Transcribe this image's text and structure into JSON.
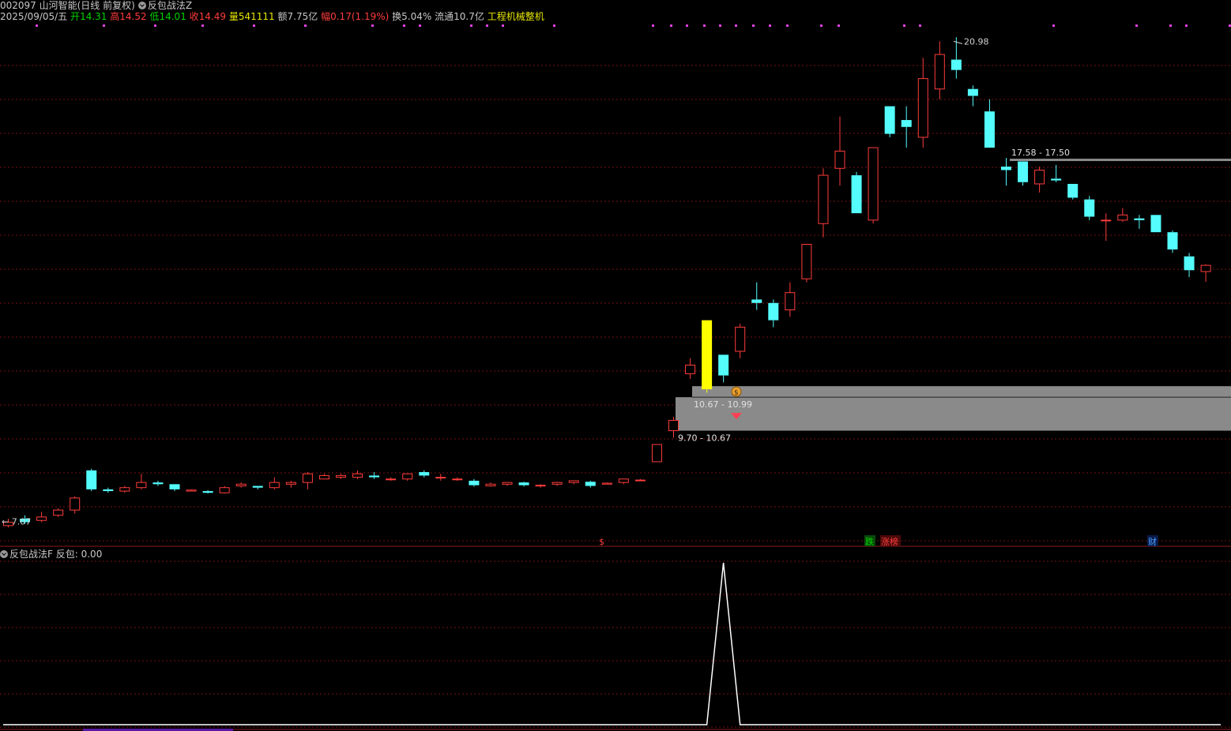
{
  "header": {
    "code_name": "002097 山河智能(日线 前复权)",
    "indicator_main": "反包战法Z",
    "date": "2025/09/05/五",
    "open_label": "开",
    "open": "14.31",
    "high_label": "高",
    "high": "14.52",
    "low_label": "低",
    "low": "14.01",
    "close_label": "收",
    "close": "14.49",
    "vol_label": "量",
    "vol": "541111",
    "amount_label": "额",
    "amount": "7.75亿",
    "change_label": "幅",
    "change": "0.17(1.19%)",
    "turnover_label": "换",
    "turnover": "5.04%",
    "float_label": "流通",
    "float": "10.7亿",
    "sector": "工程机械整机"
  },
  "main_chart": {
    "price_min": 6.9,
    "price_max": 21.4,
    "up_color": "#ff3c3c",
    "down_color": "#54fcfc",
    "candles": [
      [
        6.95,
        7.05,
        7.15,
        6.9
      ],
      [
        7.15,
        7.05,
        7.25,
        7.0
      ],
      [
        7.1,
        7.2,
        7.35,
        7.05
      ],
      [
        7.25,
        7.4,
        7.45,
        7.2
      ],
      [
        7.4,
        7.75,
        7.8,
        7.3
      ],
      [
        8.55,
        8.0,
        8.6,
        7.95
      ],
      [
        8.0,
        7.95,
        8.05,
        7.9
      ],
      [
        7.95,
        8.05,
        8.1,
        7.9
      ],
      [
        8.05,
        8.2,
        8.45,
        8.0
      ],
      [
        8.2,
        8.15,
        8.25,
        8.1
      ],
      [
        8.15,
        8.0,
        8.15,
        7.95
      ],
      [
        7.95,
        7.98,
        8.0,
        7.95
      ],
      [
        7.95,
        7.9,
        7.98,
        7.88
      ],
      [
        7.9,
        8.05,
        8.1,
        7.88
      ],
      [
        8.1,
        8.15,
        8.2,
        8.05
      ],
      [
        8.1,
        8.05,
        8.1,
        8.0
      ],
      [
        8.05,
        8.2,
        8.35,
        8.0
      ],
      [
        8.15,
        8.2,
        8.25,
        8.05
      ],
      [
        8.2,
        8.45,
        8.5,
        8.0
      ],
      [
        8.3,
        8.4,
        8.45,
        8.3
      ],
      [
        8.35,
        8.4,
        8.45,
        8.3
      ],
      [
        8.35,
        8.45,
        8.55,
        8.3
      ],
      [
        8.4,
        8.35,
        8.5,
        8.3
      ],
      [
        8.3,
        8.3,
        8.35,
        8.25
      ],
      [
        8.3,
        8.45,
        8.45,
        8.25
      ],
      [
        8.5,
        8.4,
        8.55,
        8.35
      ],
      [
        8.35,
        8.35,
        8.45,
        8.25
      ],
      [
        8.3,
        8.3,
        8.35,
        8.25
      ],
      [
        8.25,
        8.12,
        8.3,
        8.08
      ],
      [
        8.1,
        8.15,
        8.2,
        8.08
      ],
      [
        8.15,
        8.2,
        8.2,
        8.1
      ],
      [
        8.2,
        8.12,
        8.22,
        8.08
      ],
      [
        8.1,
        8.12,
        8.15,
        8.05
      ],
      [
        8.15,
        8.2,
        8.22,
        8.1
      ],
      [
        8.2,
        8.25,
        8.25,
        8.15
      ],
      [
        8.22,
        8.1,
        8.25,
        8.05
      ],
      [
        8.15,
        8.18,
        8.2,
        8.15
      ],
      [
        8.2,
        8.3,
        8.3,
        8.15
      ],
      [
        8.25,
        8.27,
        8.3,
        8.25
      ],
      [
        8.8,
        9.3,
        9.3,
        8.8
      ],
      [
        9.7,
        10.0,
        10.1,
        9.5
      ],
      [
        11.35,
        11.6,
        11.8,
        11.2
      ],
      [
        12.9,
        10.9,
        12.9,
        10.8
      ],
      [
        11.9,
        11.3,
        11.9,
        11.1
      ],
      [
        12.0,
        12.7,
        12.8,
        11.8
      ],
      [
        13.5,
        13.4,
        14.0,
        13.2
      ],
      [
        13.4,
        12.9,
        13.5,
        12.7
      ],
      [
        13.2,
        13.7,
        14.0,
        13.0
      ],
      [
        14.1,
        15.1,
        15.1,
        14.0
      ],
      [
        15.7,
        17.1,
        17.3,
        15.3
      ],
      [
        17.3,
        17.8,
        18.8,
        16.8
      ],
      [
        17.1,
        16.0,
        17.2,
        16.0
      ],
      [
        15.8,
        17.9,
        17.9,
        15.7
      ],
      [
        19.1,
        18.3,
        19.1,
        18.2
      ],
      [
        18.7,
        18.5,
        19.1,
        17.9
      ],
      [
        18.2,
        19.9,
        20.5,
        17.9
      ],
      [
        19.6,
        20.6,
        20.98,
        19.3
      ],
      [
        20.45,
        20.15,
        21.1,
        19.9
      ],
      [
        19.6,
        19.4,
        19.7,
        19.1
      ],
      [
        18.95,
        17.9,
        19.3,
        17.9
      ],
      [
        17.35,
        17.25,
        17.6,
        16.8
      ],
      [
        17.5,
        16.9,
        17.5,
        16.8
      ],
      [
        16.85,
        17.25,
        17.35,
        16.6
      ],
      [
        17.0,
        16.95,
        17.4,
        16.9
      ],
      [
        16.85,
        16.45,
        16.85,
        16.4
      ],
      [
        16.4,
        15.9,
        16.5,
        15.8
      ],
      [
        15.8,
        15.8,
        16.0,
        15.2
      ],
      [
        15.8,
        15.95,
        16.15,
        15.75
      ],
      [
        15.85,
        15.8,
        15.95,
        15.55
      ],
      [
        15.95,
        15.45,
        15.95,
        15.45
      ],
      [
        15.45,
        14.95,
        15.5,
        14.85
      ],
      [
        14.75,
        14.35,
        14.85,
        14.15
      ],
      [
        14.31,
        14.49,
        14.52,
        14.01
      ]
    ],
    "current_price": "14.49",
    "annotations": {
      "high_label": "20.98",
      "low_label": "7.07",
      "resistance": "17.58 - 17.50",
      "zone_upper": "10.67 - 10.99",
      "zone_lower": "9.70 - 10.67"
    },
    "event_tags": [
      {
        "label": "$",
        "color": "#ff3c3c"
      },
      {
        "label": "跌",
        "color": "#00d200"
      },
      {
        "label": "涨榜",
        "color": "#ff3c3c"
      },
      {
        "label": "财",
        "color": "#4aa0ff"
      }
    ]
  },
  "sub_chart": {
    "title": "反包战法F",
    "value_label": "反包:",
    "value": "0.00",
    "signal_values": [
      0,
      0,
      0,
      0,
      0,
      0,
      0,
      0,
      0,
      0,
      0,
      0,
      0,
      0,
      0,
      0,
      0,
      0,
      0,
      0,
      0,
      0,
      0,
      0,
      0,
      0,
      0,
      0,
      0,
      0,
      0,
      0,
      0,
      0,
      0,
      0,
      0,
      0,
      0,
      0,
      0,
      0,
      0,
      1,
      0,
      0,
      0,
      0,
      0,
      0,
      0,
      0,
      0,
      0,
      0,
      0,
      0,
      0,
      0,
      0,
      0,
      0,
      0,
      0,
      0,
      0,
      0,
      0,
      0,
      0,
      0,
      0,
      0
    ]
  }
}
